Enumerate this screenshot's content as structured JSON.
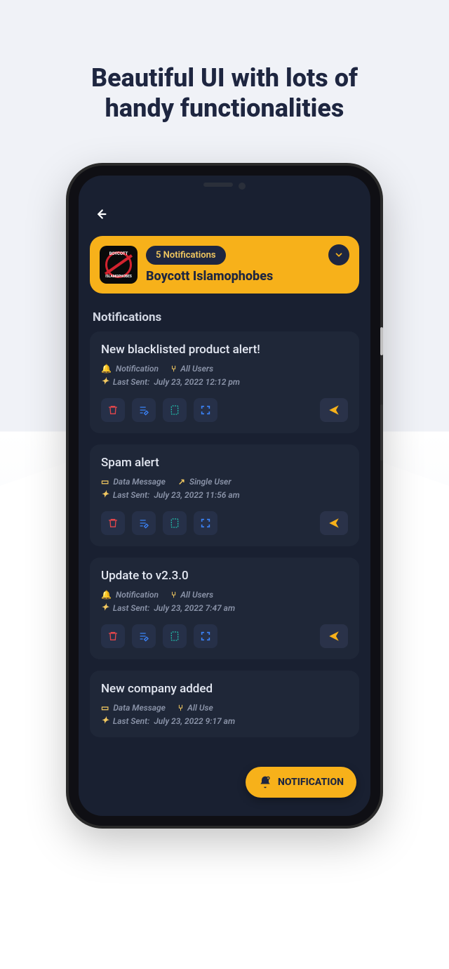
{
  "headline_line1": "Beautiful UI with lots of",
  "headline_line2": "handy functionalities",
  "hero": {
    "badge": "5 Notifications",
    "title": "Boycott Islamophobes",
    "icon_top_text": "BOYCOTT",
    "icon_bottom_text": "ISLAMOPHOBES"
  },
  "section_title": "Notifications",
  "cards": [
    {
      "title": "New blacklisted product alert!",
      "type_label": "Notification",
      "target_label": "All Users",
      "last_sent_prefix": "Last Sent:",
      "last_sent_time": "July 23, 2022 12:12 pm"
    },
    {
      "title": "Spam alert",
      "type_label": "Data Message",
      "target_label": "Single User",
      "last_sent_prefix": "Last Sent:",
      "last_sent_time": "July 23, 2022 11:56 am"
    },
    {
      "title": "Update to v2.3.0",
      "type_label": "Notification",
      "target_label": "All Users",
      "last_sent_prefix": "Last Sent:",
      "last_sent_time": "July 23, 2022 7:47 am"
    },
    {
      "title": "New company added",
      "type_label": "Data Message",
      "target_label": "All Use",
      "last_sent_prefix": "Last Sent:",
      "last_sent_time": "July 23, 2022 9:17 am"
    }
  ],
  "fab_label": "NOTIFICATION",
  "colors": {
    "accent": "#f7b11a",
    "danger": "#e0464b",
    "info": "#3b82f6",
    "teal": "#22b9a9",
    "send": "#f7b11a"
  }
}
